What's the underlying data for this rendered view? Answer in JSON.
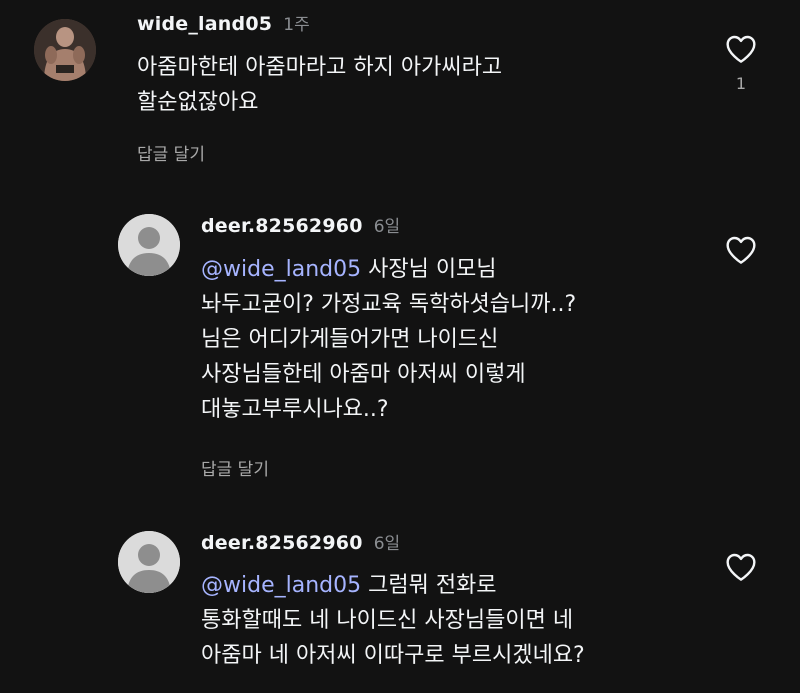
{
  "comments": [
    {
      "username": "wide_land05",
      "time": "1주",
      "lines": [
        "아줌마한테 아줌마라고 하지 아가씨라고",
        "할순없잖아요"
      ],
      "reply_label": "답글 달기",
      "like_count": "1",
      "avatar": "profile-photo"
    },
    {
      "username": "deer.82562960",
      "time": "6일",
      "mention": "@wide_land05",
      "first_line_rest": " 사장님 이모님",
      "lines": [
        "놔두고굳이? 가정교육 독학하셧습니까..?",
        "님은 어디가게들어가면 나이드신",
        "사장님들한테 아줌마 아저씨 이렇게",
        "대놓고부루시나요..?"
      ],
      "reply_label": "답글 달기",
      "avatar": "default-avatar"
    },
    {
      "username": "deer.82562960",
      "time": "6일",
      "mention": "@wide_land05",
      "first_line_rest": " 그럼뭐 전화로",
      "lines": [
        "통화할때도 네 나이드신 사장님들이면 네",
        "아줌마 네 아저씨 이따구로 부르시겠네요?"
      ],
      "avatar": "default-avatar"
    }
  ],
  "colors": {
    "background": "#121212",
    "text": "#f3f5f7",
    "secondary": "#8a8d91",
    "mention": "#a6b4ff"
  },
  "icons": {
    "like": "heart-outline-icon",
    "default_avatar": "person-silhouette-icon"
  }
}
